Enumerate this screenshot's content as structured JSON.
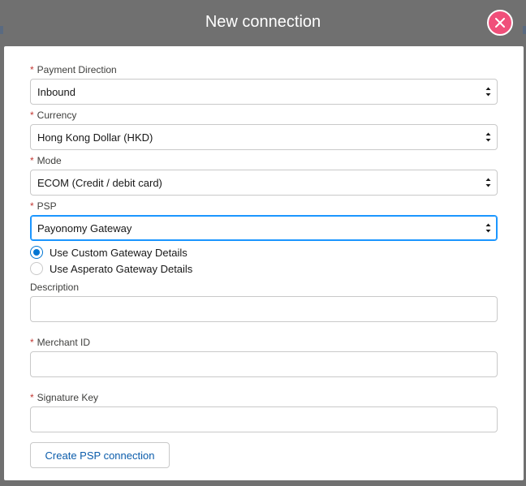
{
  "modal": {
    "title": "New connection",
    "close_icon": "close-icon"
  },
  "form": {
    "payment_direction": {
      "label": "Payment Direction",
      "required": true,
      "value": "Inbound"
    },
    "currency": {
      "label": "Currency",
      "required": true,
      "value": "Hong Kong Dollar (HKD)"
    },
    "mode": {
      "label": "Mode",
      "required": true,
      "value": "ECOM (Credit / debit card)"
    },
    "psp": {
      "label": "PSP",
      "required": true,
      "value": "Payonomy Gateway"
    },
    "gateway_options": [
      {
        "label": "Use Custom Gateway Details",
        "checked": true
      },
      {
        "label": "Use Asperato Gateway Details",
        "checked": false
      }
    ],
    "description": {
      "label": "Description",
      "value": ""
    },
    "merchant_id": {
      "label": "Merchant ID",
      "required": true,
      "value": ""
    },
    "signature_key": {
      "label": "Signature Key",
      "required": true,
      "value": ""
    },
    "required_marker": "*",
    "create_button_label": "Create PSP connection"
  },
  "colors": {
    "accent": "#0176d3",
    "close": "#f04f7a",
    "required": "#c23934",
    "focus": "#1b96ff"
  }
}
